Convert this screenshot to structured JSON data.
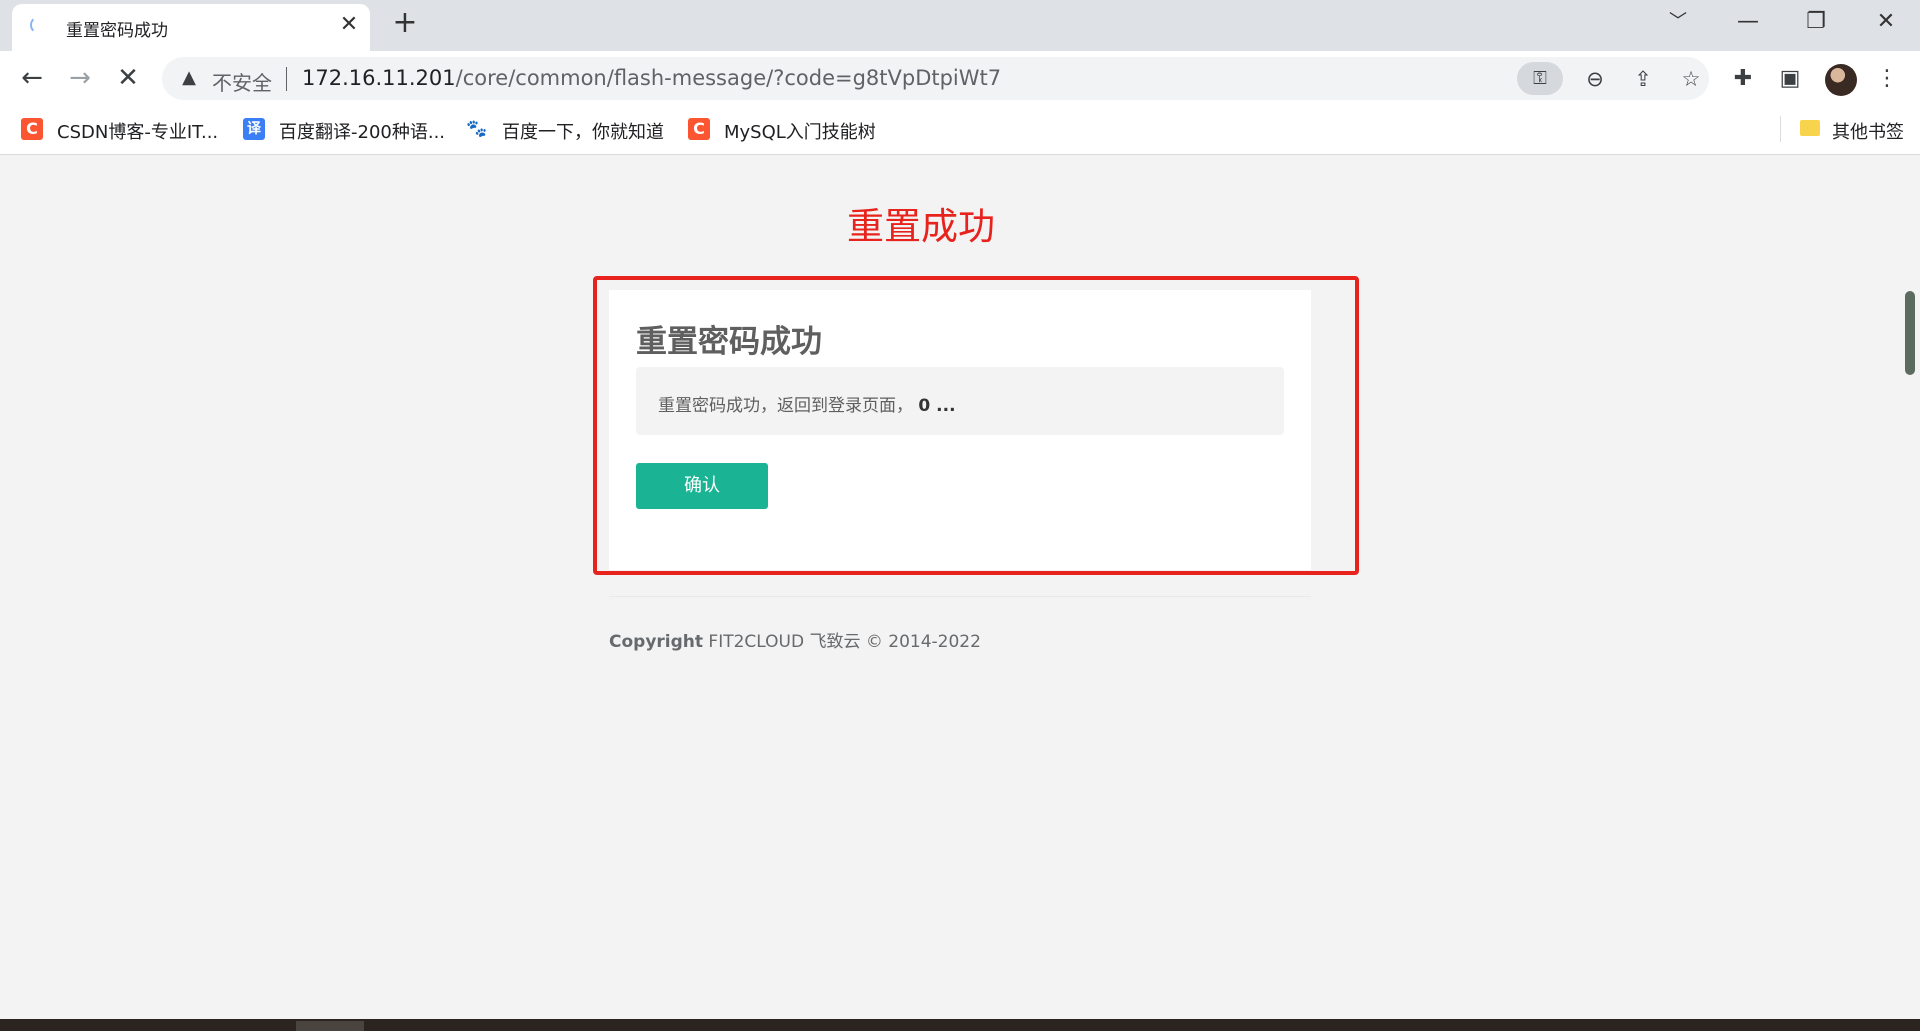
{
  "browser": {
    "tab_title": "重置密码成功",
    "tab_close": "✕",
    "new_tab": "+",
    "window_controls": [
      "﹀",
      "—",
      "❐",
      "✕"
    ],
    "toolbar": {
      "back_icon": "←",
      "forward_icon": "→",
      "stop_icon": "✕"
    },
    "omnibox": {
      "security_label": "不安全",
      "url_host": "172.16.11.201",
      "url_path": "/core/common/flash-message/?code=g8tVpDtpiWt7"
    },
    "bookmarks": [
      {
        "icon": "C",
        "icon_color": "#fc5531",
        "label": "CSDN博客-专业IT..."
      },
      {
        "icon": "译",
        "icon_color": "#3a7ff6",
        "label": "百度翻译-200种语..."
      },
      {
        "icon": "🐾",
        "icon_color": "#ffffff",
        "label": "百度一下，你就知道"
      },
      {
        "icon": "C",
        "icon_color": "#fc5531",
        "label": "MySQL入门技能树"
      }
    ],
    "other_bookmarks": "其他书签"
  },
  "page": {
    "heading": "重置成功",
    "card_title": "重置密码成功",
    "message": "重置密码成功，返回到登录页面，",
    "countdown": "0 ...",
    "confirm_button": "确认",
    "copyright_lead": "Copyright",
    "copyright_rest": " FIT2CLOUD 飞致云 © 2014-2022"
  },
  "colors": {
    "heading_red": "#e8231d",
    "button_green": "#1ab394",
    "page_bg": "#f3f3f4"
  }
}
